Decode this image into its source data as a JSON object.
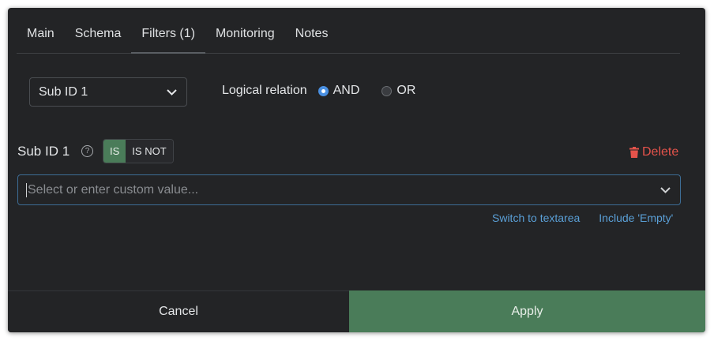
{
  "tabs": [
    {
      "label": "Main"
    },
    {
      "label": "Schema"
    },
    {
      "label": "Filters (1)",
      "active": true
    },
    {
      "label": "Monitoring"
    },
    {
      "label": "Notes"
    }
  ],
  "field_select": {
    "value": "Sub ID 1",
    "icon": "chevron-down-icon"
  },
  "logical_relation": {
    "label": "Logical relation",
    "options": [
      {
        "label": "AND",
        "selected": true
      },
      {
        "label": "OR",
        "selected": false
      }
    ]
  },
  "filter": {
    "title": "Sub ID 1",
    "help_icon": "?",
    "operators": [
      {
        "label": "IS",
        "selected": true
      },
      {
        "label": "IS NOT",
        "selected": false
      }
    ],
    "delete_label": "Delete",
    "value_input": {
      "value": "",
      "placeholder": "Select or enter custom value..."
    },
    "links": {
      "switch": "Switch to textarea",
      "include_empty": "Include 'Empty'"
    }
  },
  "footer": {
    "cancel": "Cancel",
    "apply": "Apply"
  },
  "colors": {
    "background": "#232426",
    "accent_green": "#4a7c59",
    "link_blue": "#5a9fd6",
    "delete_red": "#e5534b",
    "radio_blue": "#4a90e2"
  }
}
